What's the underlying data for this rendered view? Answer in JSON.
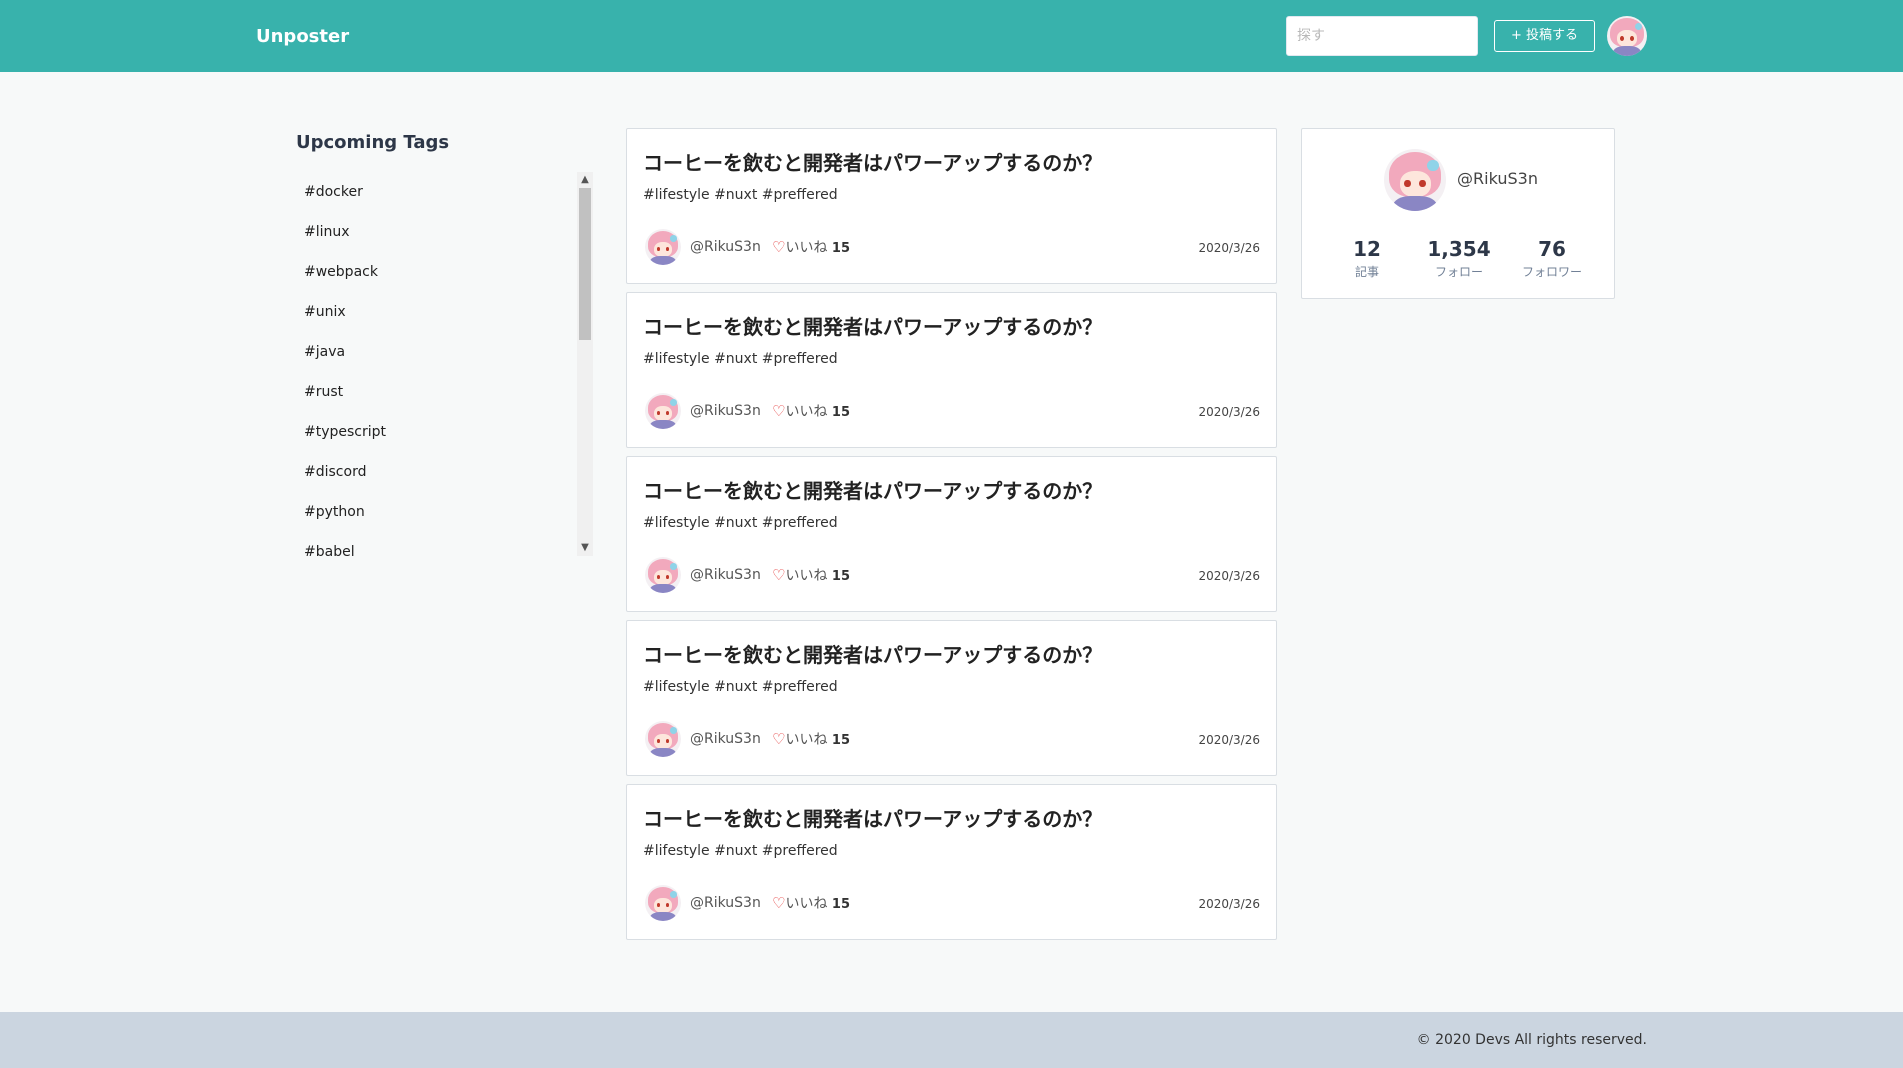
{
  "header": {
    "brand": "Unposter",
    "search_placeholder": "探す",
    "post_button": "+ 投稿する"
  },
  "sidebar": {
    "title": "Upcoming Tags",
    "tags": [
      "#docker",
      "#linux",
      "#webpack",
      "#unix",
      "#java",
      "#rust",
      "#typescript",
      "#discord",
      "#python",
      "#babel"
    ]
  },
  "posts": [
    {
      "title": "コーヒーを飲むと開発者はパワーアップするのか？",
      "tags": "#lifestyle #nuxt #preffered",
      "author": "@RikuS3n",
      "like_label": "いいね",
      "likes": "15",
      "date": "2020/3/26"
    },
    {
      "title": "コーヒーを飲むと開発者はパワーアップするのか？",
      "tags": "#lifestyle #nuxt #preffered",
      "author": "@RikuS3n",
      "like_label": "いいね",
      "likes": "15",
      "date": "2020/3/26"
    },
    {
      "title": "コーヒーを飲むと開発者はパワーアップするのか？",
      "tags": "#lifestyle #nuxt #preffered",
      "author": "@RikuS3n",
      "like_label": "いいね",
      "likes": "15",
      "date": "2020/3/26"
    },
    {
      "title": "コーヒーを飲むと開発者はパワーアップするのか？",
      "tags": "#lifestyle #nuxt #preffered",
      "author": "@RikuS3n",
      "like_label": "いいね",
      "likes": "15",
      "date": "2020/3/26"
    },
    {
      "title": "コーヒーを飲むと開発者はパワーアップするのか？",
      "tags": "#lifestyle #nuxt #preffered",
      "author": "@RikuS3n",
      "like_label": "いいね",
      "likes": "15",
      "date": "2020/3/26"
    }
  ],
  "profile": {
    "username": "@RikuS3n",
    "stats": [
      {
        "value": "12",
        "label": "記事"
      },
      {
        "value": "1,354",
        "label": "フォロー"
      },
      {
        "value": "76",
        "label": "フォロワー"
      }
    ]
  },
  "footer": {
    "copyright": "© 2020 Devs All rights reserved."
  },
  "colors": {
    "header": "#38b2ac",
    "footer": "#cbd5e0",
    "heart": "#e53e3e"
  }
}
